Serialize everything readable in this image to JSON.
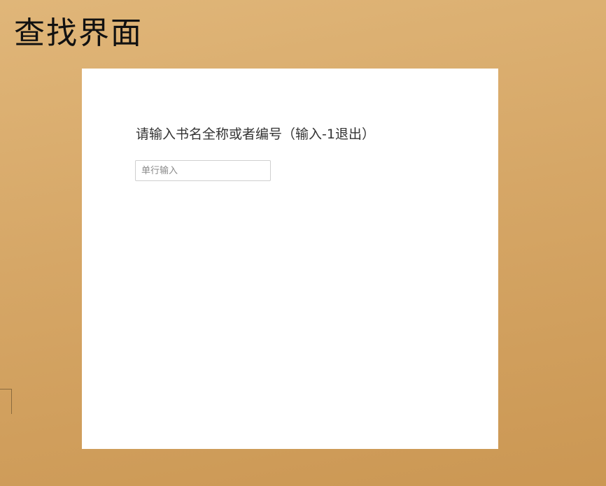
{
  "slide": {
    "title": "查找界面"
  },
  "form": {
    "prompt_label": "请输入书名全称或者编号（输入-1退出）",
    "input_placeholder": "单行输入",
    "input_value": ""
  },
  "colors": {
    "background_top": "#e0b679",
    "background_bottom": "#cb9753",
    "panel": "#ffffff",
    "title_text": "#111111",
    "label_text": "#333333",
    "input_border": "#cfcfcf"
  }
}
